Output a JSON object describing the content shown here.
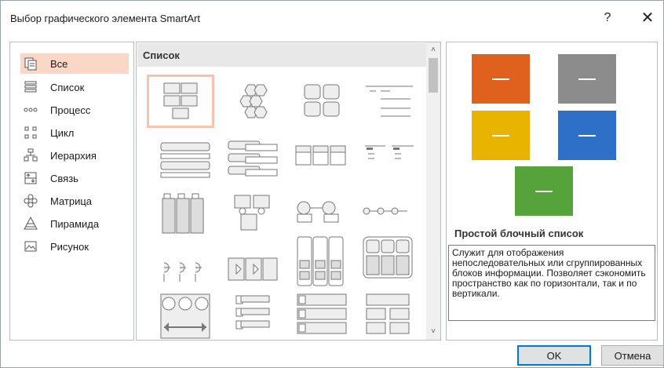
{
  "window": {
    "title": "Выбор графического элемента SmartArt",
    "help_label": "?",
    "close_label": "✕"
  },
  "categories": [
    {
      "label": "Все",
      "icon": "all-icon",
      "selected": true
    },
    {
      "label": "Список",
      "icon": "list-icon"
    },
    {
      "label": "Процесс",
      "icon": "process-icon"
    },
    {
      "label": "Цикл",
      "icon": "cycle-icon"
    },
    {
      "label": "Иерархия",
      "icon": "hierarchy-icon"
    },
    {
      "label": "Связь",
      "icon": "relationship-icon"
    },
    {
      "label": "Матрица",
      "icon": "matrix-icon"
    },
    {
      "label": "Пирамида",
      "icon": "pyramid-icon"
    },
    {
      "label": "Рисунок",
      "icon": "picture-icon"
    }
  ],
  "gallery": {
    "header": "Список",
    "scroll_up": "˄",
    "scroll_down": "˅"
  },
  "preview": {
    "layout_name": "Простой блочный список",
    "description": "Служит для отображения непоследовательных или сгруппированных блоков информации. Позволяет сэкономить пространство как по горизонтали, так и по вертикали.",
    "colors": [
      "#e0611e",
      "#8c8c8c",
      "#e8b400",
      "#2e6fc7",
      "#56a33b"
    ]
  },
  "buttons": {
    "ok": "OK",
    "cancel": "Отмена"
  }
}
